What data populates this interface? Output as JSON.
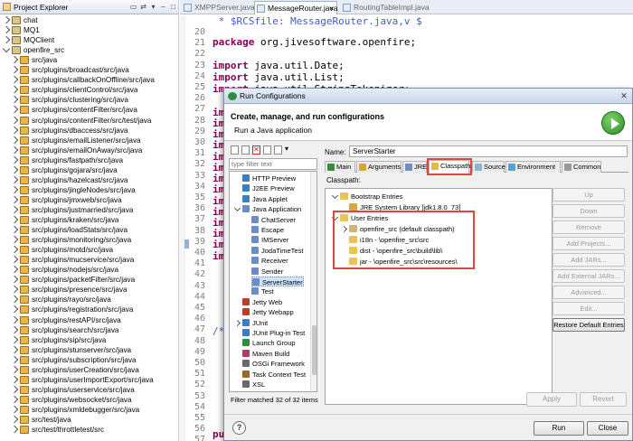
{
  "project_explorer": {
    "title": "Project Explorer",
    "projects": [
      "chat",
      "MQ1",
      "MQClient",
      "openfire_src"
    ],
    "packages": [
      "src/java",
      "src/plugins/broadcast/src/java",
      "src/plugins/callbackOnOffline/src/java",
      "src/plugins/clientControl/src/java",
      "src/plugins/clustering/src/java",
      "src/plugins/contentFilter/src/java",
      "src/plugins/contentFilter/src/test/java",
      "src/plugins/dbaccess/src/java",
      "src/plugins/emailListener/src/java",
      "src/plugins/emailOnAway/src/java",
      "src/plugins/fastpath/src/java",
      "src/plugins/gojara/src/java",
      "src/plugins/hazelcast/src/java",
      "src/plugins/jingleNodes/src/java",
      "src/plugins/jmxweb/src/java",
      "src/plugins/justmarried/src/java",
      "src/plugins/kraken/src/java",
      "src/plugins/loadStats/src/java",
      "src/plugins/monitoring/src/java",
      "src/plugins/motd/src/java",
      "src/plugins/mucservice/src/java",
      "src/plugins/nodejs/src/java",
      "src/plugins/packetFilter/src/java",
      "src/plugins/presence/src/java",
      "src/plugins/rayo/src/java",
      "src/plugins/registration/src/java",
      "src/plugins/restAPI/src/java",
      "src/plugins/search/src/java",
      "src/plugins/sip/src/java",
      "src/plugins/stunserver/src/java",
      "src/plugins/subscription/src/java",
      "src/plugins/userCreation/src/java",
      "src/plugins/userImportExport/src/java",
      "src/plugins/userservice/src/java",
      "src/plugins/websocket/src/java",
      "src/plugins/xmldebugger/src/java",
      "src/test/java",
      "src/test/throttletest/src"
    ]
  },
  "editor": {
    "tabs": [
      "XMPPServer.java",
      "MessageRouter.java",
      "RoutingTableImpl.java"
    ],
    "line_numbers": [
      "20",
      "21",
      "22",
      "23",
      "24",
      "25",
      "26",
      "27",
      "28",
      "29",
      "30",
      "31",
      "32",
      "33",
      "34",
      "35",
      "36",
      "37",
      "38",
      "39",
      "40",
      "41",
      "42",
      "43",
      "44",
      "45",
      "46",
      "47",
      "48",
      "49",
      "50",
      "51",
      "52",
      "53",
      "54",
      "55",
      "56",
      "57"
    ],
    "code": {
      "line19_prefix": " * ",
      "line19_rest": "$RCSfile: MessageRouter.java,v $",
      "pkg_kw": "package",
      "pkg_rest": " org.jivesoftware.openfire;",
      "import_kw": "import",
      "imp1": " java.util.Date;",
      "imp2": " java.util.List;",
      "imp3": " java.util.StringTokenizer;",
      "in_frag": "im",
      "comment_frag": "/*",
      "pu_frag": "pu"
    }
  },
  "dialog": {
    "title": "Run Configurations",
    "header_title": "Create, manage, and run configurations",
    "header_sub": "Run a Java application",
    "filter_placeholder": "type filter text",
    "tree": [
      {
        "label": "HTTP Preview"
      },
      {
        "label": "J2EE Preview"
      },
      {
        "label": "Java Applet"
      },
      {
        "label": "Java Application"
      },
      {
        "label": "ChatServer"
      },
      {
        "label": "Escape"
      },
      {
        "label": "IMServer"
      },
      {
        "label": "JodaTimeTest"
      },
      {
        "label": "Receiver"
      },
      {
        "label": "Sender"
      },
      {
        "label": "ServerStarter"
      },
      {
        "label": "Test"
      },
      {
        "label": "Jetty Web"
      },
      {
        "label": "Jetty Webapp"
      },
      {
        "label": "JUnit"
      },
      {
        "label": "JUnit Plug-in Test"
      },
      {
        "label": "Launch Group"
      },
      {
        "label": "Maven Build"
      },
      {
        "label": "OSGi Framework"
      },
      {
        "label": "Task Context Test"
      },
      {
        "label": "XSL"
      }
    ],
    "filter_status": "Filter matched 32 of 32 items",
    "name_label": "Name:",
    "name_value": "ServerStarter",
    "tabs": [
      "Main",
      "Arguments",
      "JRE",
      "Classpath",
      "Source",
      "Environment",
      "Common"
    ],
    "classpath_label": "Classpath:",
    "classpath_tree": {
      "bootstrap": "Bootstrap Entries",
      "jre": "JRE System Library [jdk1.8.0_73]",
      "user_entries": "User Entries",
      "project": "openfire_src (default classpath)",
      "i18n": "i18n - \\openfire_src\\src",
      "dist": "dist - \\openfire_src\\build\\lib\\",
      "jar": "jar - \\openfire_src\\src\\resources\\"
    },
    "side_buttons": [
      "Up",
      "Down",
      "Remove",
      "Add Projects...",
      "Add JARs...",
      "Add External JARs...",
      "Advanced...",
      "Edit...",
      "Restore Default Entries"
    ],
    "apply": "Apply",
    "revert": "Revert",
    "run": "Run",
    "close": "Close",
    "help": "?"
  },
  "colors": {
    "highlight_red": "#e0463a",
    "keyword": "#7f0055",
    "comment": "#3f5fbf"
  }
}
